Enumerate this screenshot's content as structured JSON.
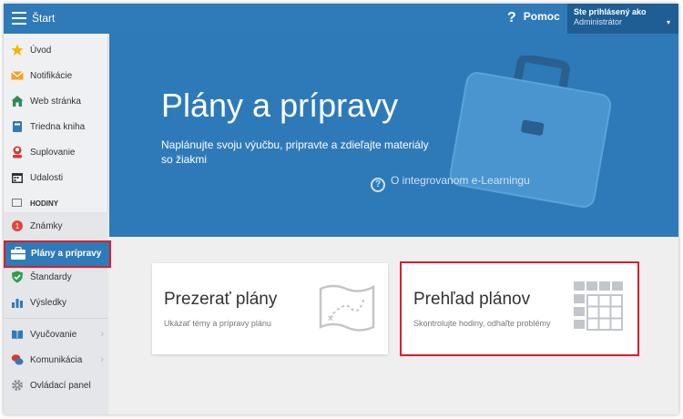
{
  "topbar": {
    "title": "Štart",
    "help_icon": "?",
    "help_label": "Pomoc",
    "user_line1": "Ste prihlásený ako",
    "user_line2": "Administrátor",
    "caret": "▾"
  },
  "sidebar": {
    "items": [
      {
        "label": "Úvod",
        "icon": "star-icon"
      },
      {
        "label": "Notifikácie",
        "icon": "envelope-icon"
      },
      {
        "label": "Web stránka",
        "icon": "house-icon"
      },
      {
        "label": "Triedna kniha",
        "icon": "book-icon"
      },
      {
        "label": "Suplovanie",
        "icon": "person-icon"
      },
      {
        "label": "Udalosti",
        "icon": "calendar-icon"
      }
    ],
    "section_header": "HODINY",
    "group2": [
      {
        "label": "Známky",
        "icon": "grade-icon"
      },
      {
        "label": "Plány a prípravy",
        "icon": "briefcase-icon",
        "active": true
      },
      {
        "label": "Štandardy",
        "icon": "shield-check-icon"
      },
      {
        "label": "Výsledky",
        "icon": "bar-chart-icon"
      },
      {
        "label": "Vyučovanie",
        "icon": "open-book-icon",
        "arrow": "›"
      },
      {
        "label": "Komunikácia",
        "icon": "chat-icon",
        "arrow": "›"
      },
      {
        "label": "Ovládací panel",
        "icon": "gear-icon"
      }
    ]
  },
  "hero": {
    "title": "Plány a prípravy",
    "subtitle": "Naplánujte svoju výučbu, pripravte a zdieľajte materiály so žiakmi",
    "link_icon": "?",
    "link": "O integrovanom e-Learningu"
  },
  "cards": [
    {
      "title": "Prezerať plány",
      "subtitle": "Ukázať témy a prípravy plánu",
      "icon": "map-icon"
    },
    {
      "title": "Prehľad plánov",
      "subtitle": "Skontrolujte hodiny, odhaľte problémy",
      "icon": "grid-icon"
    }
  ],
  "colors": {
    "primary": "#2f7ab8",
    "highlight": "#d6202b",
    "background": "#efefef"
  }
}
